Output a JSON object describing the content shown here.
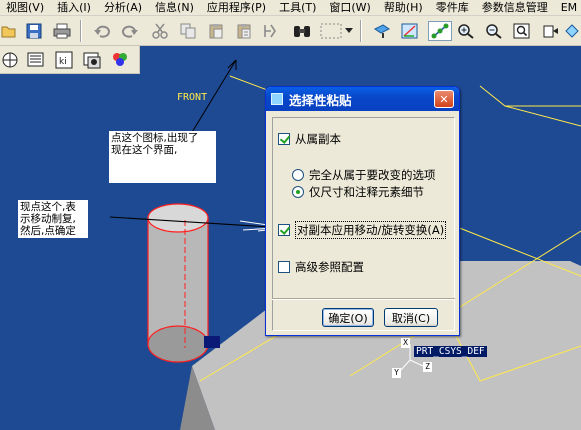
{
  "menubar": {
    "items": [
      "视图(V)",
      "插入(I)",
      "分析(A)",
      "信息(N)",
      "应用程序(P)",
      "工具(T)",
      "窗口(W)",
      "帮助(H)",
      "零件库",
      "参数信息管理",
      "EM"
    ]
  },
  "toolbar": {
    "icons": [
      "open-icon",
      "save-icon",
      "print-icon",
      "undo-icon",
      "redo-icon",
      "cut-icon",
      "copy-icon",
      "paste-icon",
      "paste-special-icon",
      "regenerate-icon",
      "find-icon",
      "select-box-icon",
      "repaint-icon",
      "orient-icon",
      "view-manager-icon",
      "spin-center-icon",
      "zoom-in-icon",
      "zoom-out-icon",
      "refit-icon",
      "datum-plane-icon"
    ]
  },
  "annotations": {
    "note1": "点这个图标,出现了\n现在这个界面,",
    "note2": "现点这个,表\n示移动制复,\n然后,点确定"
  },
  "model": {
    "datum_front": "FRONT",
    "csys_name": "PRT_CSYS_DEF",
    "axis_x": "X",
    "axis_y": "Y",
    "axis_z": "Z"
  },
  "dialog": {
    "title": "选择性粘贴",
    "close_label": "✕",
    "dependent_copy": {
      "label": "从属副本",
      "checked": true
    },
    "option_full": {
      "label": "完全从属于要改变的选项",
      "selected": false
    },
    "option_dims": {
      "label": "仅尺寸和注释元素细节",
      "selected": true
    },
    "apply_move": {
      "label": "对副本应用移动/旋转变换(A)",
      "checked": true
    },
    "advanced_ref": {
      "label": "高级参照配置",
      "checked": false
    },
    "ok_label": "确定(O)",
    "cancel_label": "取消(C)"
  },
  "colors": {
    "viewport_bg": "#1e4a93",
    "datum_yellow": "#ffe94a",
    "cylinder_red": "#ff2020",
    "plate_gray": "#a8a8a8"
  }
}
